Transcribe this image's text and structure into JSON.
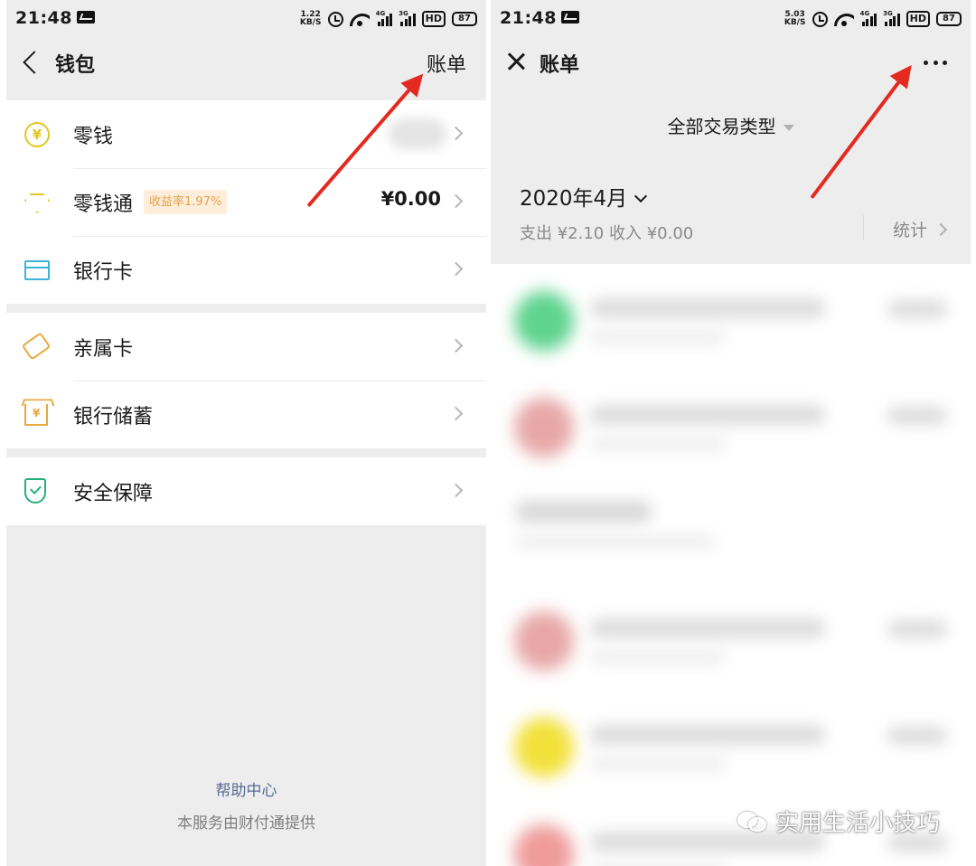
{
  "left_screen": {
    "status_bar": {
      "time": "21:48",
      "speed_value": "1.22",
      "speed_unit": "KB/S",
      "network": "4G",
      "network2": "3G",
      "hd": "HD",
      "battery": "87"
    },
    "header": {
      "title": "钱包",
      "action_label": "账单"
    },
    "groups": [
      {
        "items": [
          {
            "label": "零钱",
            "icon": "coin-icon"
          },
          {
            "label": "零钱通",
            "icon": "diamond-icon",
            "badge": "收益率1.97%",
            "value": "¥0.00"
          },
          {
            "label": "银行卡",
            "icon": "bank-card-icon"
          }
        ]
      },
      {
        "items": [
          {
            "label": "亲属卡",
            "icon": "family-card-icon"
          },
          {
            "label": "银行储蓄",
            "icon": "bank-savings-icon"
          }
        ]
      },
      {
        "items": [
          {
            "label": "安全保障",
            "icon": "shield-icon"
          }
        ]
      }
    ],
    "footer": {
      "help_center": "帮助中心",
      "provider_note": "本服务由财付通提供"
    }
  },
  "right_screen": {
    "status_bar": {
      "time": "21:48",
      "speed_value": "5.03",
      "speed_unit": "KB/S",
      "network": "4G",
      "network2": "3G",
      "hd": "HD",
      "battery": "87"
    },
    "header": {
      "title": "账单"
    },
    "filter_label": "全部交易类型",
    "month": "2020年4月",
    "summary": "支出 ¥2.10 收入 ¥0.00",
    "stats_label": "统计",
    "transactions_avatar_colors": [
      "#5fd38f",
      "#e8a7a7",
      null,
      "#e8a7a7",
      "#f2e13a",
      "#ef9b9b"
    ]
  },
  "watermark": "实用生活小技巧",
  "colors": {
    "arrow": "#e42a20",
    "link": "#576b95",
    "badge_text": "#e3a34e",
    "badge_bg": "#fdeedb"
  }
}
